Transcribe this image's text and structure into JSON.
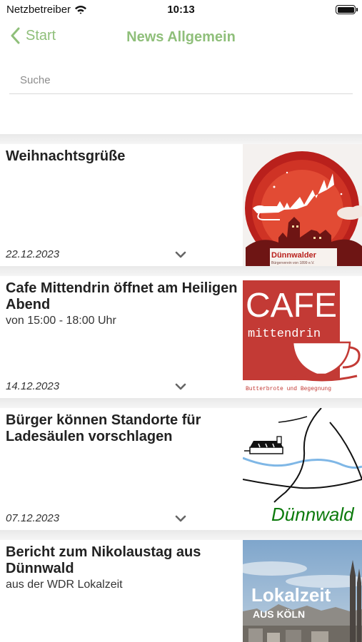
{
  "status_bar": {
    "carrier": "Netzbetreiber",
    "time": "10:13"
  },
  "nav": {
    "back_label": "Start",
    "title": "News Allgemein"
  },
  "search": {
    "placeholder": "Suche",
    "value": ""
  },
  "colors": {
    "accent": "#8fbf7a"
  },
  "news": [
    {
      "title": "Weihnachtsgrüße",
      "subtitle": "",
      "date": "22.12.2023",
      "thumbnail": {
        "icon": "christmas-papercut-image",
        "brand": "Dünnwalder",
        "tagline": "Bürgerverein von 1899 e.V."
      }
    },
    {
      "title": "Cafe Mittendrin öffnet am Heiligen Abend",
      "subtitle": "von 15:00 - 18:00 Uhr",
      "date": "14.12.2023",
      "thumbnail": {
        "icon": "cafe-logo-image",
        "heading": "CAFE",
        "name": "mittendrin",
        "tagline": "Butterbrote und Begegnung"
      }
    },
    {
      "title": "Bürger können Standorte für Ladesäulen vorschlagen",
      "subtitle": "",
      "date": "07.12.2023",
      "thumbnail": {
        "icon": "map-sketch-image",
        "label": "Dünnwald"
      }
    },
    {
      "title": "Bericht zum Nikolaustag aus Dünnwald",
      "subtitle": "aus der WDR Lokalzeit",
      "date": "",
      "thumbnail": {
        "icon": "lokalzeit-city-image",
        "heading": "Lokalzeit",
        "subheading": "AUS KÖLN"
      }
    }
  ]
}
